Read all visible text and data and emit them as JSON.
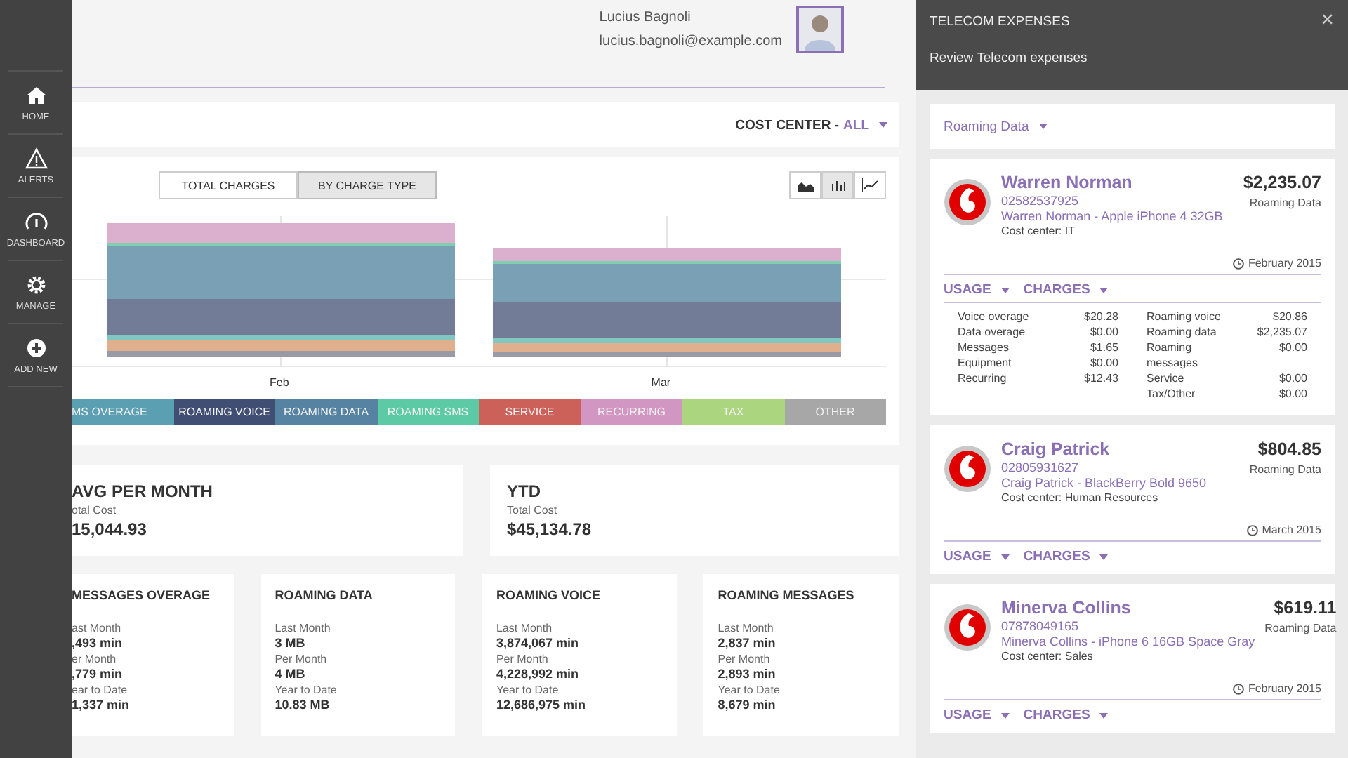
{
  "sidebar": {
    "items": [
      {
        "kind": "home",
        "label": "HOME"
      },
      {
        "kind": "alert",
        "label": "ALERTS"
      },
      {
        "kind": "gauge",
        "label": "DASHBOARD"
      },
      {
        "kind": "gear",
        "label": "MANAGE"
      },
      {
        "kind": "plus",
        "label": "ADD NEW"
      }
    ]
  },
  "user": {
    "name": "Lucius Bagnoli",
    "email": "lucius.bagnoli@example.com"
  },
  "cost_center": {
    "label": "COST CENTER - ",
    "value": "ALL"
  },
  "chart": {
    "toggles": [
      {
        "label": "TOTAL CHARGES",
        "selected": false
      },
      {
        "label": "BY CHARGE TYPE",
        "selected": true
      }
    ],
    "chart_types": [
      {
        "kind": "area",
        "selected": false
      },
      {
        "kind": "bar",
        "selected": true
      },
      {
        "kind": "line",
        "selected": false
      }
    ],
    "x_labels": [
      "Feb",
      "Mar"
    ],
    "legend": [
      {
        "label": "MS OVERAGE",
        "color": "#5b9fb3"
      },
      {
        "label": "ROAMING VOICE",
        "color": "#3f4e72"
      },
      {
        "label": "ROAMING DATA",
        "color": "#5683a1"
      },
      {
        "label": "ROAMING SMS",
        "color": "#5ccaa4"
      },
      {
        "label": "SERVICE",
        "color": "#cc6159"
      },
      {
        "label": "RECURRING",
        "color": "#d296c2"
      },
      {
        "label": "TAX",
        "color": "#acd57f"
      },
      {
        "label": "OTHER",
        "color": "#a7a7a7"
      }
    ]
  },
  "summary": [
    {
      "title": "AVG PER MONTH",
      "label": "otal Cost",
      "value": "15,044.93"
    },
    {
      "title": "YTD",
      "label": "Total Cost",
      "value": "$45,134.78"
    }
  ],
  "stats": [
    {
      "title": "MESSAGES OVERAGE",
      "rows": [
        {
          "label": "ast Month",
          "value": ",493 min"
        },
        {
          "label": "er Month",
          "value": ",779 min"
        },
        {
          "label": "ear to Date",
          "value": "1,337 min"
        }
      ]
    },
    {
      "title": "ROAMING DATA",
      "rows": [
        {
          "label": "Last Month",
          "value": "3 MB"
        },
        {
          "label": "Per Month",
          "value": "4 MB"
        },
        {
          "label": "Year to Date",
          "value": "10.83 MB"
        }
      ]
    },
    {
      "title": "ROAMING VOICE",
      "rows": [
        {
          "label": "Last Month",
          "value": "3,874,067 min"
        },
        {
          "label": "Per Month",
          "value": "4,228,992 min"
        },
        {
          "label": "Year to Date",
          "value": "12,686,975 min"
        }
      ]
    },
    {
      "title": "ROAMING MESSAGES",
      "rows": [
        {
          "label": "Last Month",
          "value": "2,837 min"
        },
        {
          "label": "Per Month",
          "value": "2,893 min"
        },
        {
          "label": "Year to Date",
          "value": "8,679 min"
        }
      ]
    }
  ],
  "panel": {
    "title": "TELECOM EXPENSES",
    "close": "×",
    "subtitle": "Review Telecom expenses",
    "filter": "Roaming Data",
    "cards": [
      {
        "name": "Warren Norman",
        "number": "02582537925",
        "device": "Warren Norman - Apple iPhone 4 32GB",
        "cost_center": "Cost center: IT",
        "amount": "$2,235.07",
        "type": "Roaming Data",
        "date": "February 2015",
        "usage": "USAGE",
        "charges_label": "CHARGES",
        "expanded": true,
        "charges": [
          [
            {
              "label": "Voice overage",
              "value": "$20.28"
            },
            {
              "label": "Data overage",
              "value": "$0.00"
            },
            {
              "label": "Messages",
              "value": "$1.65"
            },
            {
              "label": "Equipment",
              "value": "$0.00"
            },
            {
              "label": "Recurring",
              "value": "$12.43"
            }
          ],
          [
            {
              "label": "Roaming voice",
              "value": "$20.86"
            },
            {
              "label": "Roaming data",
              "value": "$2,235.07"
            },
            {
              "label": "Roaming messages",
              "value": "$0.00"
            },
            {
              "label": "Service",
              "value": "$0.00"
            },
            {
              "label": "Tax/Other",
              "value": "$0.00"
            }
          ]
        ]
      },
      {
        "name": "Craig Patrick",
        "number": "02805931627",
        "device": "Craig Patrick - BlackBerry Bold 9650",
        "cost_center": "Cost center: Human Resources",
        "amount": "$804.85",
        "type": "Roaming Data",
        "date": "March 2015",
        "usage": "USAGE",
        "charges_label": "CHARGES",
        "expanded": false
      },
      {
        "name": "Minerva Collins",
        "number": "07878049165",
        "device": "Minerva Collins - iPhone 6 16GB Space Gray",
        "cost_center": "Cost center: Sales",
        "amount": "$619.11",
        "type": "Roaming Data",
        "date": "February 2015",
        "usage": "USAGE",
        "charges_label": "CHARGES",
        "expanded": false
      }
    ]
  }
}
